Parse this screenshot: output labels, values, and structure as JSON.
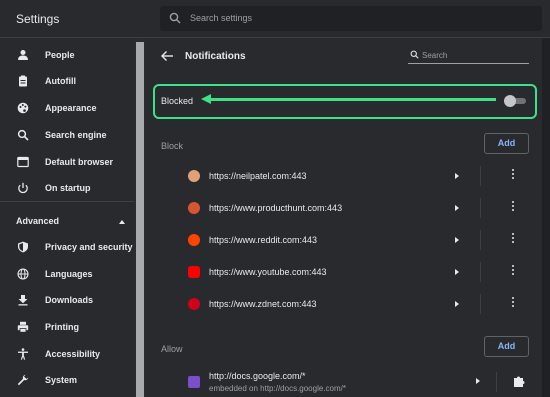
{
  "header": {
    "title": "Settings",
    "search_placeholder": "Search settings"
  },
  "sidebar": {
    "items": [
      {
        "label": "People",
        "icon": "person-icon"
      },
      {
        "label": "Autofill",
        "icon": "clipboard-icon"
      },
      {
        "label": "Appearance",
        "icon": "palette-icon"
      },
      {
        "label": "Search engine",
        "icon": "search-icon"
      },
      {
        "label": "Default browser",
        "icon": "browser-window-icon"
      },
      {
        "label": "On startup",
        "icon": "power-icon"
      }
    ],
    "advanced_label": "Advanced",
    "advanced_items": [
      {
        "label": "Privacy and security",
        "icon": "shield-icon"
      },
      {
        "label": "Languages",
        "icon": "globe-icon"
      },
      {
        "label": "Downloads",
        "icon": "download-icon"
      },
      {
        "label": "Printing",
        "icon": "printer-icon"
      },
      {
        "label": "Accessibility",
        "icon": "accessibility-icon"
      },
      {
        "label": "System",
        "icon": "wrench-icon"
      }
    ]
  },
  "panel": {
    "title": "Notifications",
    "search_placeholder": "Search",
    "blocked_label": "Blocked",
    "toggle_on": false,
    "block_label": "Block",
    "allow_label": "Allow",
    "add_label": "Add",
    "blocked_sites": [
      {
        "url": "https://neilpatel.com:443",
        "color": "#e0a07a"
      },
      {
        "url": "https://www.producthunt.com:443",
        "color": "#da552f"
      },
      {
        "url": "https://www.reddit.com:443",
        "color": "#ff4500"
      },
      {
        "url": "https://www.youtube.com:443",
        "color": "#ff0000"
      },
      {
        "url": "https://www.zdnet.com:443",
        "color": "#d0021b"
      }
    ],
    "allowed_sites": [
      {
        "url": "http://docs.google.com/*",
        "sub": "embedded on http://docs.google.com/*",
        "color": "#7b4fc9"
      }
    ]
  },
  "colors": {
    "accent": "#8ab4f8",
    "highlight": "#3fe08a"
  }
}
